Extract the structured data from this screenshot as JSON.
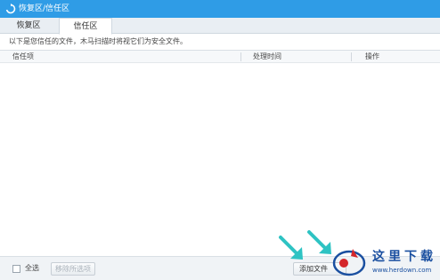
{
  "window": {
    "title": "恢复区/信任区"
  },
  "tabs": [
    {
      "label": "恢复区",
      "active": false
    },
    {
      "label": "信任区",
      "active": true
    }
  ],
  "notice": "以下是您信任的文件，木马扫描时将视它们为安全文件。",
  "table": {
    "columns": [
      "信任项",
      "处理时间",
      "操作"
    ],
    "rows": []
  },
  "footer": {
    "select_all_label": "全选",
    "remove_button_label": "移除所选项",
    "add_button_label": "添加文件"
  },
  "watermark": {
    "text": "这里下载",
    "url": "www.herdown.com"
  },
  "colors": {
    "titlebar": "#2f9ce6",
    "arrows": "#2ec3c3",
    "watermark": "#1a4fa0",
    "logo_accent": "#d4262b"
  },
  "icons": {
    "title": "refresh-icon",
    "arrow": "pointer-arrow-icon"
  }
}
